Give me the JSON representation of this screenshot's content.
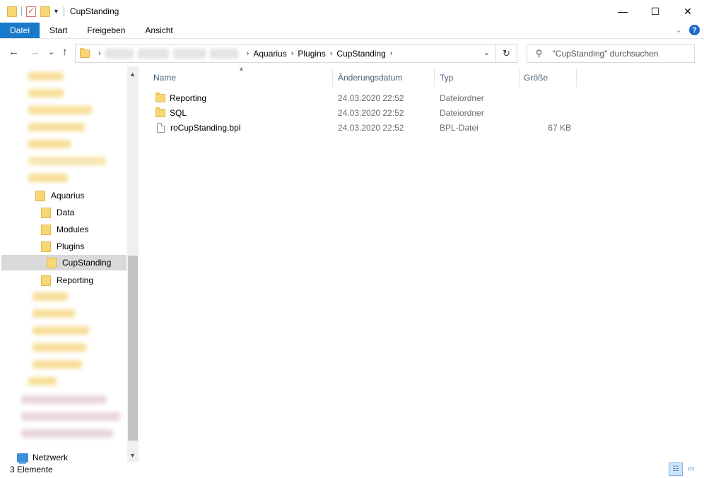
{
  "window": {
    "title": "CupStanding",
    "controls": {
      "minimize": "—",
      "maximize": "☐",
      "close": "✕"
    }
  },
  "ribbon": {
    "tabs": [
      {
        "label": "Datei",
        "active": true
      },
      {
        "label": "Start"
      },
      {
        "label": "Freigeben"
      },
      {
        "label": "Ansicht"
      }
    ],
    "help": "?",
    "expand": "⌄"
  },
  "nav": {
    "back": "←",
    "forward": "→",
    "recent": "⌄",
    "up": "↑",
    "refresh": "↻",
    "address": {
      "separator": "›",
      "crumbs": [
        "Aquarius",
        "Plugins",
        "CupStanding"
      ]
    },
    "search_placeholder": "\"CupStanding\" durchsuchen"
  },
  "tree": {
    "items": [
      {
        "label": "Aquarius"
      },
      {
        "label": "Data"
      },
      {
        "label": "Modules"
      },
      {
        "label": "Plugins"
      },
      {
        "label": "CupStanding",
        "selected": true
      },
      {
        "label": "Reporting"
      }
    ],
    "network": "Netzwerk"
  },
  "filelist": {
    "columns": {
      "name": "Name",
      "modified": "Änderungsdatum",
      "type": "Typ",
      "size": "Größe"
    },
    "rows": [
      {
        "name": "Reporting",
        "modified": "24.03.2020 22:52",
        "type": "Dateiordner",
        "size": ""
      },
      {
        "name": "SQL",
        "modified": "24.03.2020 22:52",
        "type": "Dateiordner",
        "size": ""
      },
      {
        "name": "roCupStanding.bpl",
        "modified": "24.03.2020 22:52",
        "type": "BPL-Datei",
        "size": "67 KB"
      }
    ]
  },
  "status": {
    "count": "3 Elemente"
  },
  "colors": {
    "file_tab": "#1979ca",
    "folder": "#f8d775",
    "selection": "#d9d9d9",
    "header_text": "#4c607a"
  }
}
